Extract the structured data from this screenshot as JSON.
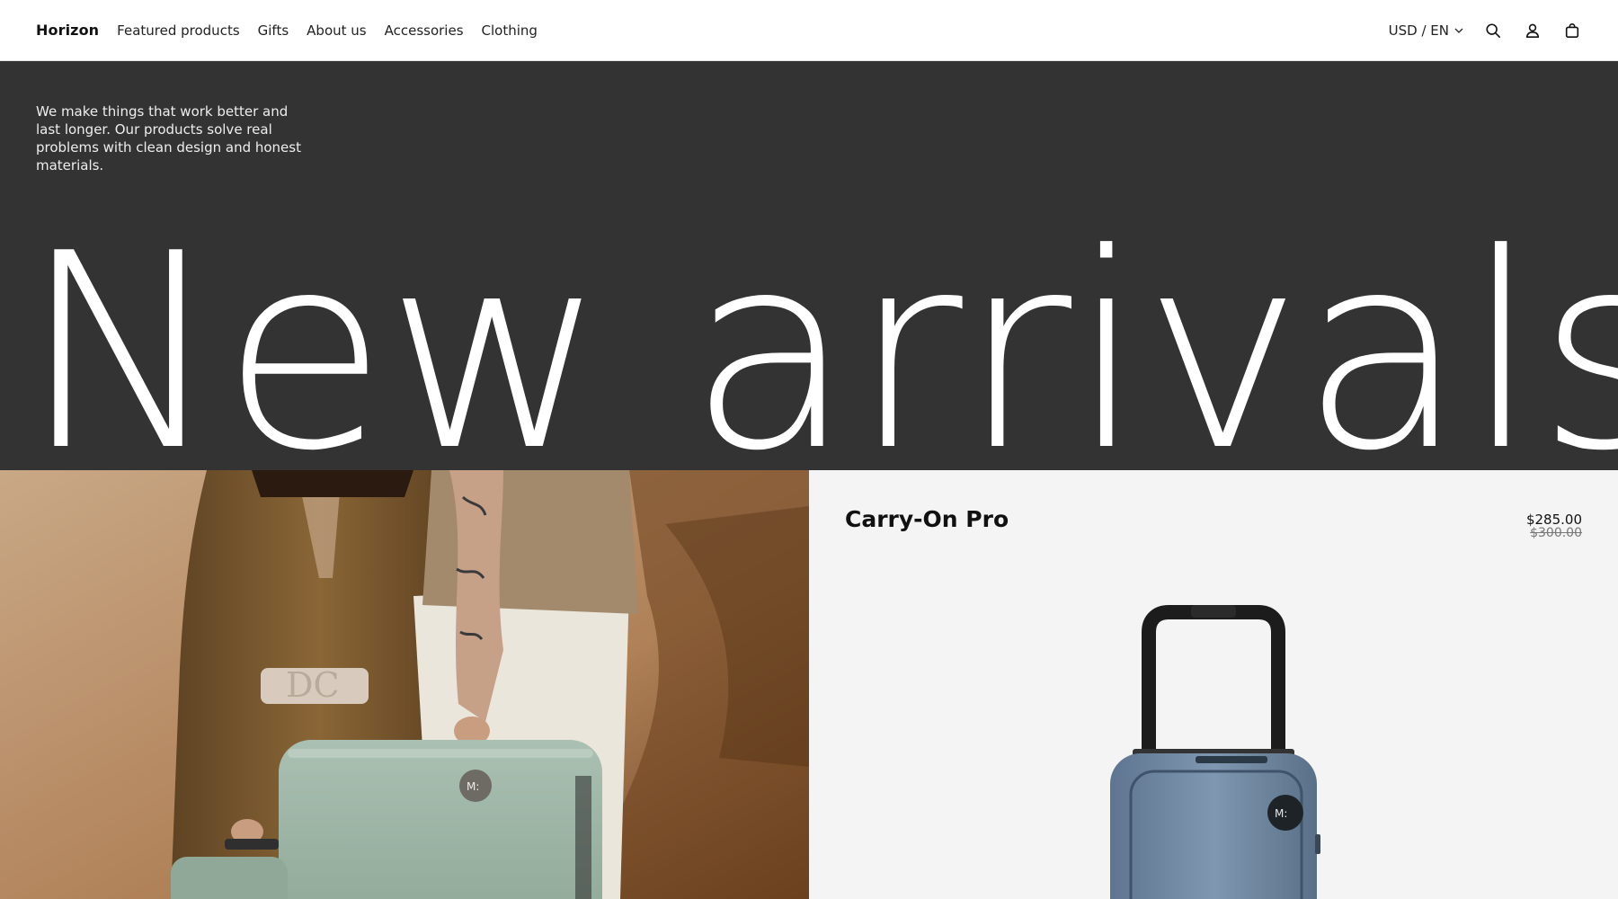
{
  "header": {
    "brand": "Horizon",
    "nav": [
      "Featured products",
      "Gifts",
      "About us",
      "Accessories",
      "Clothing"
    ],
    "locale": "USD / EN",
    "icons": [
      "search-icon",
      "account-icon",
      "cart-icon"
    ]
  },
  "hero": {
    "intro": "We make things that work better and last longer. Our products solve real problems with clean design and honest materials.",
    "title": "New arrivals",
    "background": "#333333"
  },
  "product": {
    "name": "Carry-On Pro",
    "price": "$285.00",
    "compare_price": "$300.00",
    "logo_text": "M:"
  },
  "lifestyle": {
    "logo_text": "M:"
  }
}
